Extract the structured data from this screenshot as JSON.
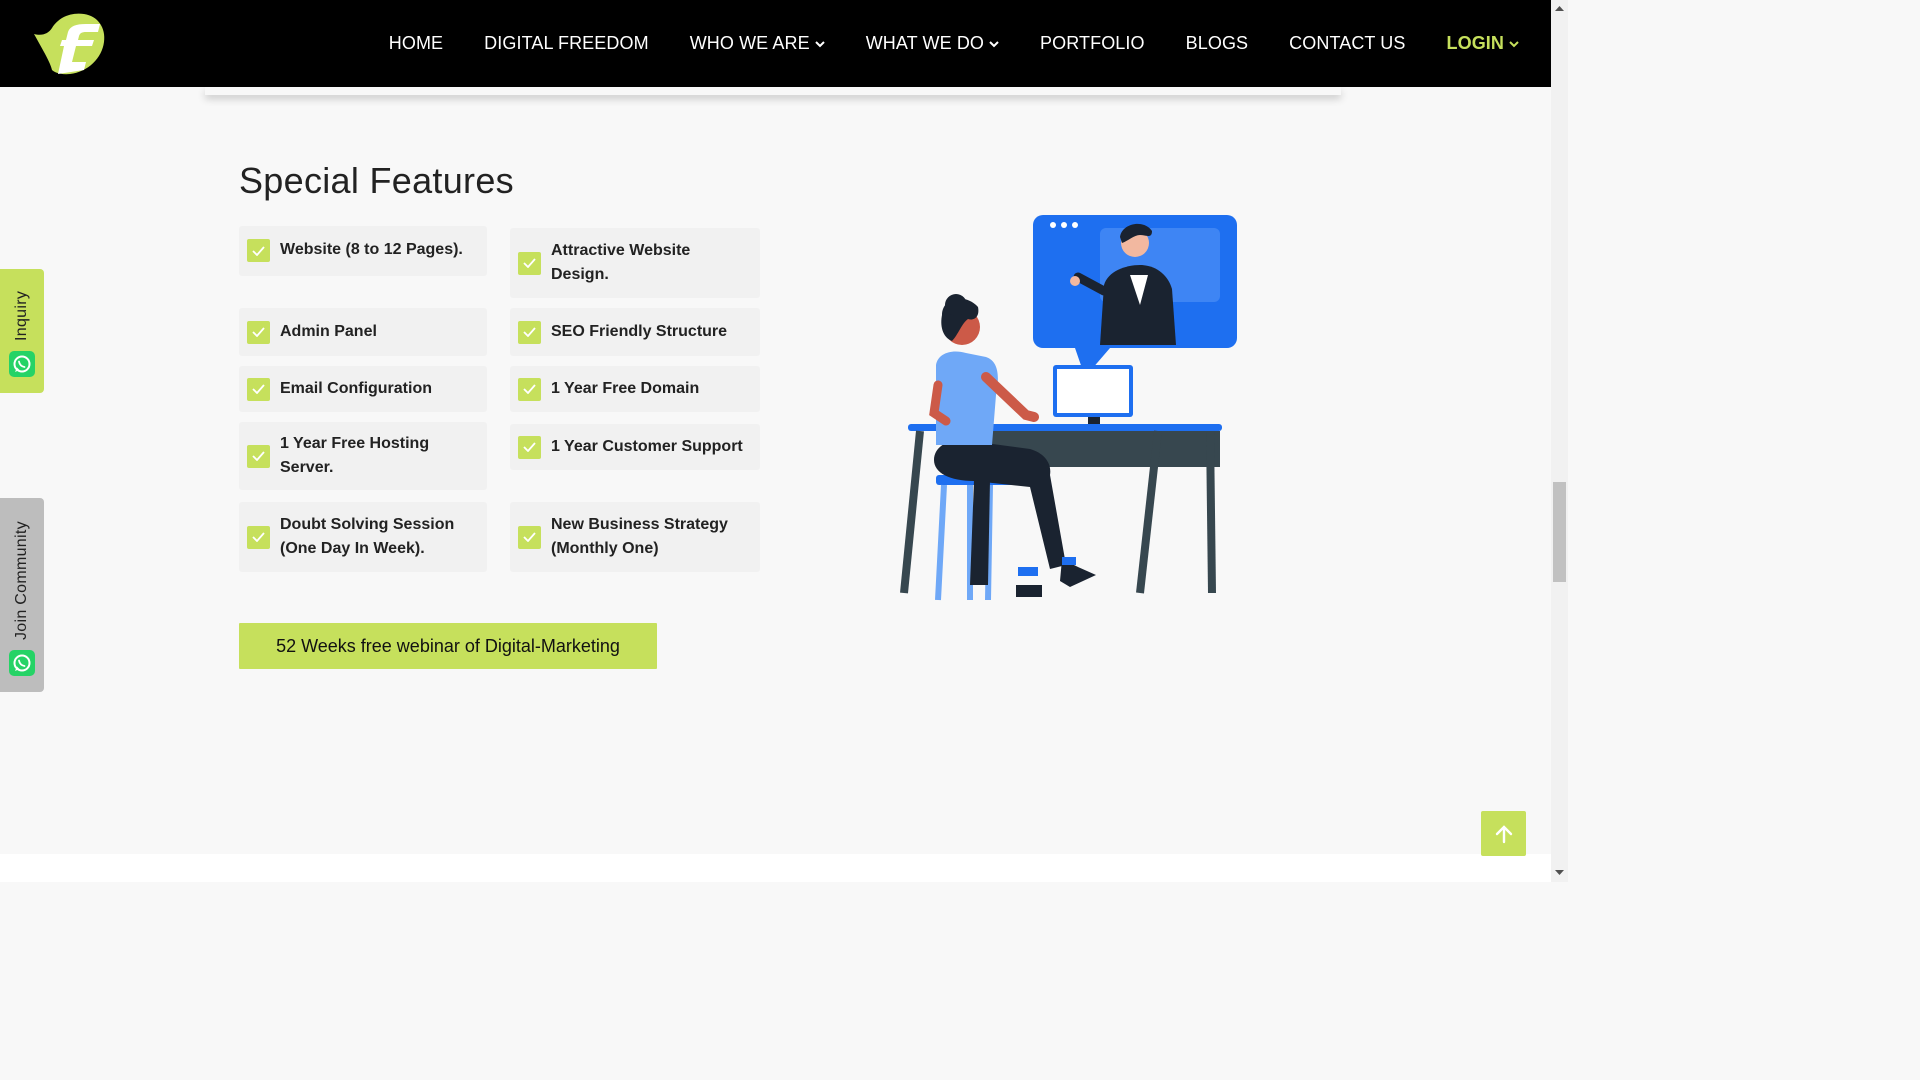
{
  "nav": {
    "items": [
      {
        "label": "HOME",
        "has_dropdown": false
      },
      {
        "label": "DIGITAL FREEDOM",
        "has_dropdown": false
      },
      {
        "label": "WHO WE ARE",
        "has_dropdown": true
      },
      {
        "label": "WHAT WE DO",
        "has_dropdown": true
      },
      {
        "label": "PORTFOLIO",
        "has_dropdown": false
      },
      {
        "label": "BLOGS",
        "has_dropdown": false
      },
      {
        "label": "CONTACT US",
        "has_dropdown": false
      }
    ],
    "login_label": "LOGIN"
  },
  "side": {
    "inquiry_label": "Inquiry",
    "community_label": "Join Community"
  },
  "section": {
    "title": "Special Features",
    "features_left": [
      "Website (8 to 12 Pages).",
      "Admin Panel",
      "Email Configuration",
      "1 Year Free Hosting Server.",
      "Doubt Solving Session (One Day In Week)."
    ],
    "features_right": [
      "Attractive Website Design.",
      "SEO Friendly Structure",
      "1 Year Free Domain",
      "1 Year Customer Support",
      "New Business Strategy (Monthly One)"
    ],
    "cta_label": "52 Weeks free webinar of Digital-Marketing"
  },
  "colors": {
    "accent": "#c6e05c",
    "navbar": "#000000",
    "illustration_blue": "#1e6ff0",
    "whatsapp": "#25d366"
  },
  "icons": {
    "check": "check-icon",
    "back_to_top": "arrow-up-icon",
    "whatsapp": "whatsapp-icon",
    "dropdown": "chevron-down-icon"
  }
}
